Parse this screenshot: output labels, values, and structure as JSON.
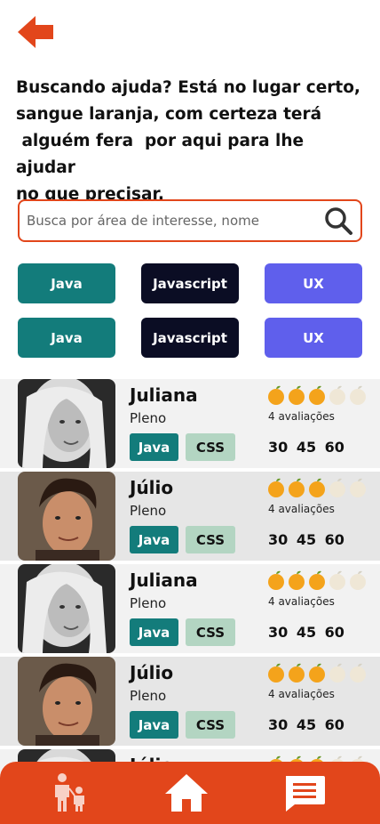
{
  "header": {
    "headline": "Buscando ajuda? Está no lugar certo,\nsangue laranja, com certeza terá\n alguém fera  por aqui para lhe ajudar\nno que precisar."
  },
  "search": {
    "placeholder": "Busca por área de interesse, nome",
    "value": ""
  },
  "filters": {
    "row1": [
      "Java",
      "Javascript",
      "UX"
    ],
    "row2": [
      "Java",
      "Javascript",
      "UX"
    ]
  },
  "mentors": [
    {
      "name": "Juliana",
      "level": "Pleno",
      "skills": [
        "Java",
        "CSS"
      ],
      "rating": 3,
      "max_rating": 5,
      "reviews": "4 avaliações",
      "prices": "30 45 60"
    },
    {
      "name": "Júlio",
      "level": "Pleno",
      "skills": [
        "Java",
        "CSS"
      ],
      "rating": 3,
      "max_rating": 5,
      "reviews": "4 avaliações",
      "prices": "30 45 60"
    },
    {
      "name": "Juliana",
      "level": "Pleno",
      "skills": [
        "Java",
        "CSS"
      ],
      "rating": 3,
      "max_rating": 5,
      "reviews": "4 avaliações",
      "prices": "30 45 60"
    },
    {
      "name": "Júlio",
      "level": "Pleno",
      "skills": [
        "Java",
        "CSS"
      ],
      "rating": 3,
      "max_rating": 5,
      "reviews": "4 avaliações",
      "prices": "30 45 60"
    },
    {
      "name": "Júlio",
      "level": "",
      "skills": [],
      "rating": 3,
      "max_rating": 5,
      "reviews": "",
      "prices": ""
    }
  ],
  "nav": {
    "items": [
      "mentor-child-icon",
      "home-icon",
      "chat-icon"
    ]
  },
  "colors": {
    "accent": "#e2461b",
    "java": "#137c7b",
    "javascript": "#0b0d24",
    "ux": "#5f5fec",
    "css": "#b3d5c2"
  }
}
